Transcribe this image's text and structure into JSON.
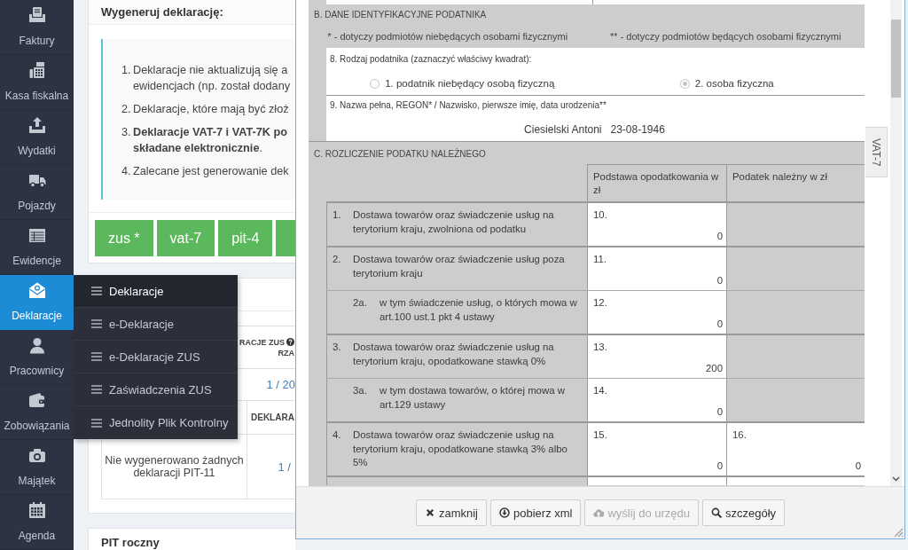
{
  "sidebar": {
    "items": [
      {
        "label": "Faktury",
        "selected": false
      },
      {
        "label": "Kasa fiskalna",
        "selected": false
      },
      {
        "label": "Wydatki",
        "selected": false
      },
      {
        "label": "Pojazdy",
        "selected": false
      },
      {
        "label": "Ewidencje",
        "selected": false
      },
      {
        "label": "Deklaracje",
        "selected": true
      },
      {
        "label": "Pracownicy",
        "selected": false
      },
      {
        "label": "Zobowiązania",
        "selected": false
      },
      {
        "label": "Majątek",
        "selected": false
      },
      {
        "label": "Agenda",
        "selected": false
      }
    ]
  },
  "submenu": {
    "items": [
      {
        "label": "Deklaracje",
        "selected": true
      },
      {
        "label": "e-Deklaracje",
        "selected": false
      },
      {
        "label": "e-Deklaracje ZUS",
        "selected": false
      },
      {
        "label": "Zaświadczenia ZUS",
        "selected": false
      },
      {
        "label": "Jednolity Plik Kontrolny",
        "selected": false
      }
    ]
  },
  "generate_panel": {
    "title": "Wygeneruj deklarację:",
    "notes": [
      {
        "number": "1.",
        "text": "Deklaracje nie aktualizują się a\newidencjach (np. został dodany"
      },
      {
        "number": "2.",
        "text": "Deklaracje, które mają być złoż"
      },
      {
        "number": "3.",
        "text": "**Deklaracje VAT-7 i VAT-7K po**\n**składane elektronicznie**."
      },
      {
        "number": "4.",
        "text": "Zalecane jest generowanie dek"
      }
    ],
    "buttons": [
      {
        "label": "zus *",
        "cut": false
      },
      {
        "label": "vat-7",
        "cut": false
      },
      {
        "label": "pit-4",
        "cut": false
      },
      {
        "cut": true
      }
    ]
  },
  "summary_panel": {
    "zus_table": {
      "header": "RACJE ZUS",
      "header_line_2": "RZA",
      "help": true,
      "cell": "1 / 20"
    },
    "pit11_table": {
      "header": "DEKLARA",
      "message": "Nie wygenerowano żadnych deklaracji PIT-11",
      "cell": "1 /"
    }
  },
  "pit_panel": {
    "title": "PIT roczny"
  },
  "modal": {
    "section_b": {
      "title": "B. DANE IDENTYFIKACYJNE PODATNIKA",
      "notes": [
        "* - dotyczy podmiotów niebędących osobami fizycznymi",
        "** - dotyczy podmiotów będących osobami fizycznymi"
      ],
      "taxpayer_type": {
        "label": "8. Rodzaj podatnika (zaznaczyć właściwy kwadrat):",
        "disabled": true,
        "options": [
          {
            "label": "1. podatnik niebędący osobą fizyczną",
            "selected": false
          },
          {
            "label": "2. osoba fizyczna",
            "selected": true
          }
        ]
      },
      "identity": {
        "label": "9. Nazwa pełna, REGON* / Nazwisko, pierwsze imię, data urodzenia**",
        "name": "Ciesielski Antoni",
        "birth_date": "23-08-1946"
      }
    },
    "section_c": {
      "title": "C. ROZLICZENIE PODATKU NALEŻNEGO",
      "columns": [
        "Podstawa opodatkowania w zł",
        "Podatek należny w zł"
      ],
      "rows": [
        {
          "kind": "main",
          "number": "1.",
          "description": "Dostawa towarów oraz świadczenie usług na terytorium kraju, zwolniona od podatku",
          "base": {
            "field": "10.",
            "value": "0"
          }
        },
        {
          "kind": "main",
          "number": "2.",
          "description": "Dostawa towarów oraz świadczenie usług poza terytorium kraju",
          "base": {
            "field": "11.",
            "value": "0"
          }
        },
        {
          "kind": "sub",
          "number": "2a.",
          "description": "w tym świadczenie usług, o których mowa w art.100 ust.1 pkt 4 ustawy",
          "base": {
            "field": "12.",
            "value": "0"
          }
        },
        {
          "kind": "main",
          "number": "3.",
          "description": "Dostawa towarów oraz świadczenie usług na terytorium kraju, opodatkowane stawką 0%",
          "base": {
            "field": "13.",
            "value": "200"
          }
        },
        {
          "kind": "sub",
          "number": "3a.",
          "description": "w tym dostawa towarów, o której mowa w art.129 ustawy",
          "base": {
            "field": "14.",
            "value": "0"
          }
        },
        {
          "kind": "main",
          "number": "4.",
          "description": "Dostawa towarów oraz świadczenie usług na terytorium kraju, opodatkowane stawką 3% albo 5%",
          "base": {
            "field": "15.",
            "value": "0"
          },
          "tax": {
            "field": "16.",
            "value": "0"
          }
        },
        {
          "kind": "cut"
        }
      ]
    },
    "side_tab": {
      "label": "VAT-7"
    },
    "buttons": [
      {
        "label": "zamknij",
        "disabled": false
      },
      {
        "label": "pobierz xml",
        "disabled": false
      },
      {
        "label": "wyślij do urzędu",
        "disabled": true
      },
      {
        "label": "szczegóły",
        "disabled": false
      }
    ]
  }
}
